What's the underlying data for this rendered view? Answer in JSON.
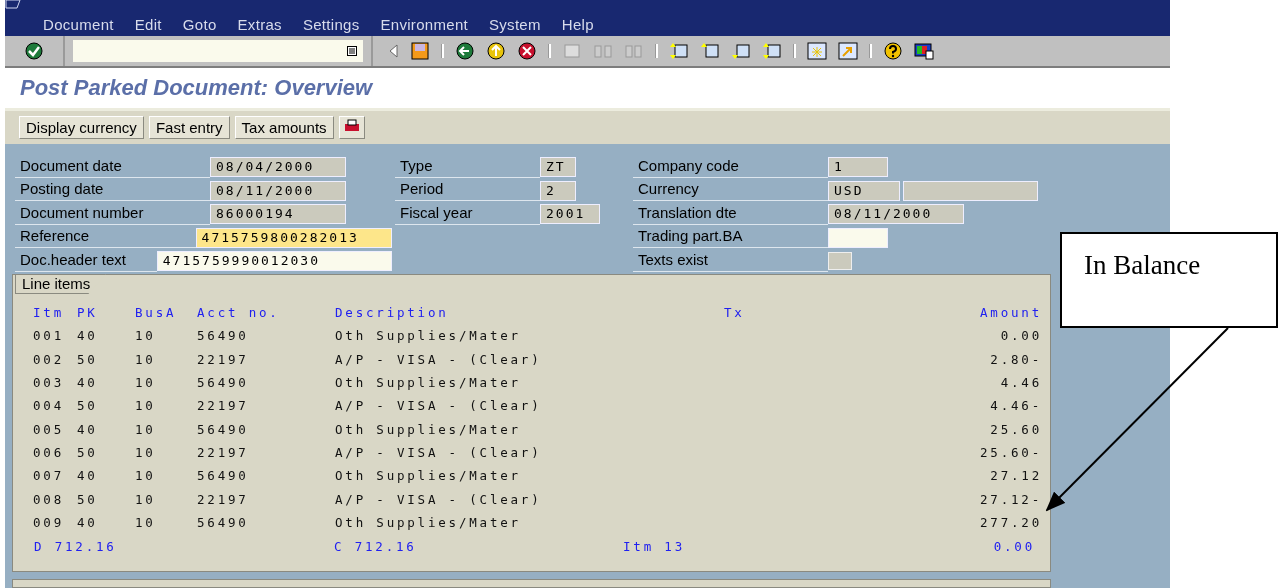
{
  "menu": [
    "Document",
    "Edit",
    "Goto",
    "Extras",
    "Settings",
    "Environment",
    "System",
    "Help"
  ],
  "title": "Post Parked Document: Overview",
  "app_buttons": [
    "Display currency",
    "Fast entry",
    "Tax amounts"
  ],
  "header_columns": [
    [
      {
        "label": "Document date",
        "kind": "text",
        "fields": [
          {
            "value": "08/04/2000",
            "kind": "display"
          }
        ]
      },
      {
        "label": "Posting date",
        "kind": "text",
        "fields": [
          {
            "value": "08/11/2000",
            "kind": "display"
          }
        ]
      },
      {
        "label": "Document number",
        "kind": "text",
        "fields": [
          {
            "value": "86000194",
            "kind": "display"
          }
        ]
      },
      {
        "label": "Reference",
        "kind": "text",
        "fields": [
          {
            "value": "4715759800282013",
            "kind": "focused"
          }
        ]
      },
      {
        "label": "Doc.header text",
        "kind": "text",
        "fields": [
          {
            "value": "4715759990012030",
            "kind": "input"
          }
        ]
      }
    ],
    [
      {
        "label": "Type",
        "kind": "text",
        "fields": [
          {
            "value": "ZT",
            "kind": "display"
          }
        ]
      },
      {
        "label": "Period",
        "kind": "text",
        "fields": [
          {
            "value": "2",
            "kind": "display"
          }
        ]
      },
      {
        "label": "Fiscal year",
        "kind": "text",
        "fields": [
          {
            "value": "2001",
            "kind": "display"
          }
        ]
      }
    ],
    [
      {
        "label": "Company code",
        "kind": "text",
        "fields": [
          {
            "value": "1",
            "kind": "display"
          }
        ]
      },
      {
        "label": "Currency",
        "kind": "text",
        "fields": [
          {
            "value": "USD",
            "kind": "display"
          },
          {
            "kind": "display"
          }
        ]
      },
      {
        "label": "Translation dte",
        "kind": "text",
        "fields": [
          {
            "value": "08/11/2000",
            "kind": "display"
          }
        ]
      },
      {
        "label": "Trading part.BA",
        "kind": "text",
        "fields": [
          {
            "kind": "input"
          }
        ]
      },
      {
        "label": "Texts exist",
        "kind": "checkbox",
        "checked": false
      }
    ]
  ],
  "line_items": {
    "tab": "Line items",
    "columns": [
      "Itm",
      "PK",
      "BusA",
      "Acct no.",
      "Description",
      "Tx",
      "Amount"
    ],
    "rows": [
      [
        "001",
        "40",
        "10",
        "56490",
        "Oth Supplies/Mater",
        "",
        "0.00"
      ],
      [
        "002",
        "50",
        "10",
        "22197",
        "A/P - VISA - (Clear)",
        "",
        "2.80-"
      ],
      [
        "003",
        "40",
        "10",
        "56490",
        "Oth Supplies/Mater",
        "",
        "4.46"
      ],
      [
        "004",
        "50",
        "10",
        "22197",
        "A/P - VISA - (Clear)",
        "",
        "4.46-"
      ],
      [
        "005",
        "40",
        "10",
        "56490",
        "Oth Supplies/Mater",
        "",
        "25.60"
      ],
      [
        "006",
        "50",
        "10",
        "22197",
        "A/P - VISA - (Clear)",
        "",
        "25.60-"
      ],
      [
        "007",
        "40",
        "10",
        "56490",
        "Oth Supplies/Mater",
        "",
        "27.12"
      ],
      [
        "008",
        "50",
        "10",
        "22197",
        "A/P - VISA - (Clear)",
        "",
        "27.12-"
      ],
      [
        "009",
        "40",
        "10",
        "56490",
        "Oth Supplies/Mater",
        "",
        "277.20"
      ]
    ],
    "totals": {
      "debit": "D 712.16",
      "credit": "C 712.16",
      "items": "Itm 13",
      "balance": "0.00"
    }
  },
  "callout": {
    "text": "In Balance"
  }
}
